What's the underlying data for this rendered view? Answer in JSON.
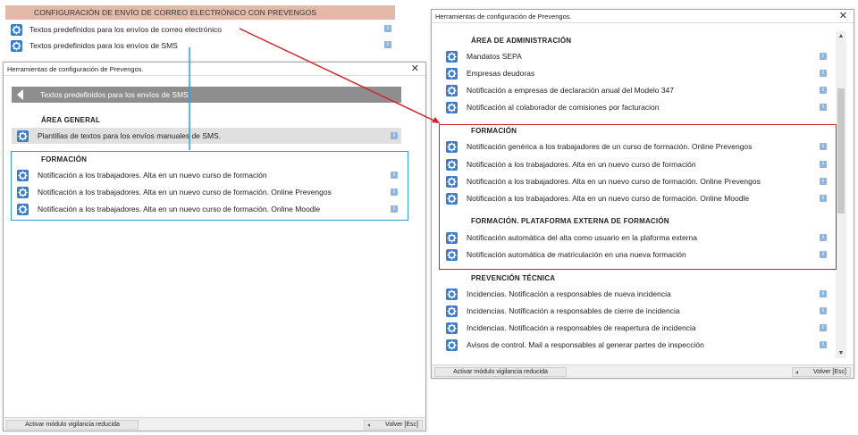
{
  "config_panel": {
    "header": "CONFIGURACIÓN DE ENVÍO DE CORREO ELECTRÓNICO CON PREVENGOS",
    "items": [
      {
        "label": "Textos predefinidos para los envíos de correo electrónico"
      },
      {
        "label": "Textos predefinidos para los envíos de SMS"
      }
    ]
  },
  "left_window": {
    "title": "Herramientas de configuración de Prevengos.",
    "back_bar_label": "Textos predefinidos para los envíos de SMS",
    "sections": [
      {
        "title": "ÁREA GENERAL",
        "items": [
          {
            "label": "Plantillas de textos para los envíos manuales de SMS."
          }
        ]
      },
      {
        "title": "FORMACIÓN",
        "items": [
          {
            "label": "Notificación a los trabajadores. Alta en un nuevo curso de formación"
          },
          {
            "label": "Notificación a los trabajadores. Alta en un nuevo curso de formación. Online Prevengos"
          },
          {
            "label": "Notificación a los trabajadores. Alta en un nuevo curso de formación. Online Moodle"
          }
        ]
      }
    ],
    "footer": {
      "left_button": "Activar módulo vigilancia reducida",
      "right_button": "Volver  [Esc]"
    }
  },
  "right_window": {
    "title": "Herramientas de configuración de Prevengos.",
    "sections": [
      {
        "title": "ÁREA DE ADMINISTRACIÓN",
        "items": [
          {
            "label": "Mandatos SEPA"
          },
          {
            "label": "Empresas deudoras"
          },
          {
            "label": "Notificación a empresas de declaración anual del Modelo 347"
          },
          {
            "label": "Notificación al colaborador de comisiones por facturacion"
          }
        ]
      },
      {
        "title": "FORMACIÓN",
        "items": [
          {
            "label": "Notificación genérica a los trabajadores de un curso de formación. Online Prevengos"
          },
          {
            "label": "Notificación a los trabajadores. Alta en un nuevo curso de formación"
          },
          {
            "label": "Notificación a los trabajadores. Alta en un nuevo curso de formación. Online Prevengos"
          },
          {
            "label": "Notificación a los trabajadores. Alta en un nuevo curso de formación. Online Moodle"
          }
        ]
      },
      {
        "title": "FORMACIÓN. PLATAFORMA EXTERNA DE FORMACIÓN",
        "items": [
          {
            "label": "Notificación automática del alta como usuario en la plaforma externa"
          },
          {
            "label": "Notificación automática de matriculación en una nueva formación"
          }
        ]
      },
      {
        "title": "PREVENCIÓN TÉCNICA",
        "items": [
          {
            "label": "Incidencias. Notificación a responsables de nueva incidencia"
          },
          {
            "label": "Incidencias. Notificación a responsables de cierre de incidencia"
          },
          {
            "label": "Incidencias. Notificación a responsables de reapertura de incidencia"
          },
          {
            "label": "Avisos de control. Mail a responsables al generar partes de inspección"
          }
        ]
      }
    ],
    "footer": {
      "left_button": "Activar módulo vigilancia reducida",
      "right_button": "Volver  [Esc]"
    }
  },
  "icons": {
    "settings": "gear-icon",
    "info": "info-icon",
    "close": "close-icon",
    "back": "back-arrow-icon"
  },
  "colors": {
    "gear_blue": "#3a7bc8",
    "header_salmon": "#e3b9aa",
    "annotation_blue": "#2f9fe0",
    "annotation_red": "#d2232a",
    "back_bar_gray": "#8e8e8e"
  }
}
